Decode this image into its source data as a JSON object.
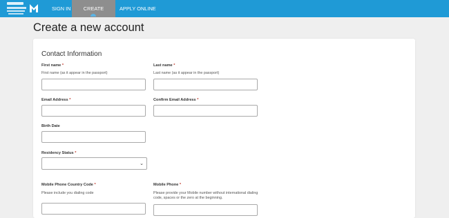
{
  "nav": {
    "sign_in": "SIGN IN",
    "create_account": "CREATE ACCOUNT",
    "apply_online": "APPLY ONLINE"
  },
  "page": {
    "title": "Create a new account"
  },
  "form": {
    "section_title": "Contact Information",
    "first_name": {
      "label": "First name",
      "hint": "First name (as it appear in the passport)",
      "value": ""
    },
    "last_name": {
      "label": "Last name",
      "hint": "Last name (as it appear in the passport)",
      "value": ""
    },
    "email": {
      "label": "Email Address",
      "value": ""
    },
    "confirm_email": {
      "label": "Confirm Email Address",
      "value": ""
    },
    "birth_date": {
      "label": "Birth Date",
      "value": ""
    },
    "residency_status": {
      "label": "Residency Status",
      "value": ""
    },
    "country_code": {
      "label": "Mobile Phone Country Code",
      "hint": "Please include you dialing code"
    },
    "mobile_phone": {
      "label": "Mobile Phone",
      "hint": "Please provide your Mobile number without international dialing code, spaces or the zero at the beginning."
    },
    "required_mark": "*"
  },
  "colors": {
    "topbar": "#1f9ad6",
    "active_tab": "#8e8e8e",
    "background": "#efefef"
  }
}
